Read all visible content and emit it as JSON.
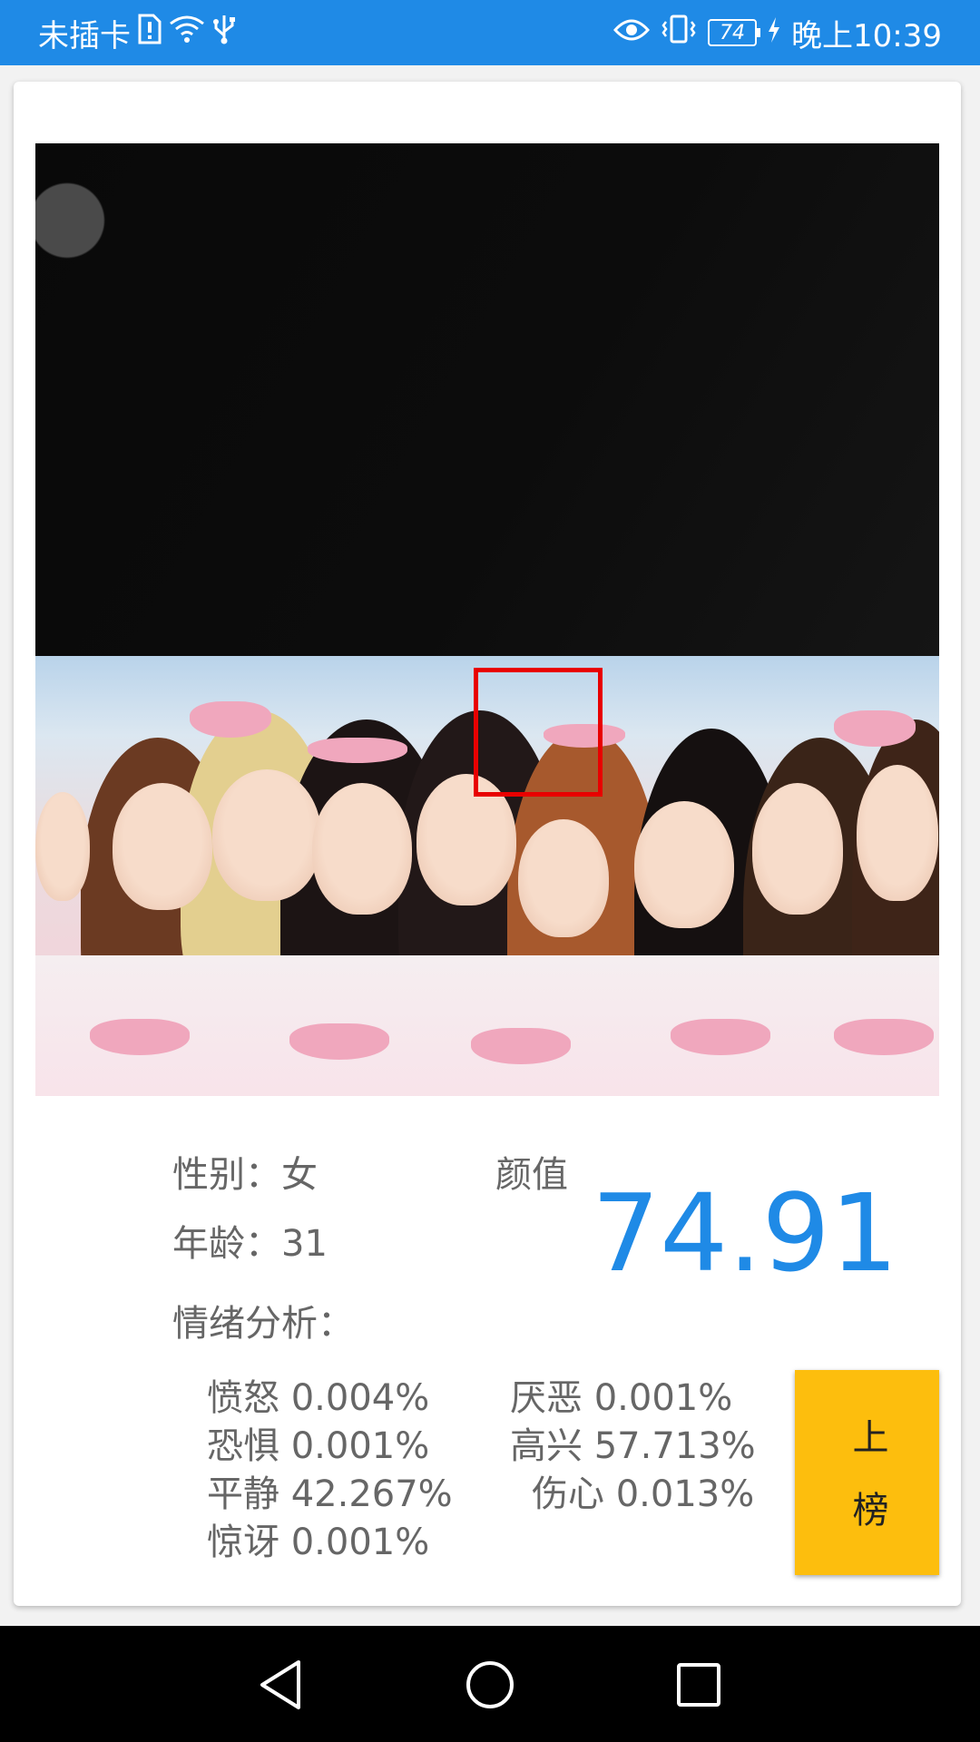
{
  "status_bar": {
    "carrier": "未插卡",
    "battery": "74",
    "time": "晚上10:39",
    "icons": [
      "sim-alert-icon",
      "wifi-icon",
      "usb-icon",
      "eye-icon",
      "vibrate-icon",
      "battery-icon",
      "charging-icon"
    ]
  },
  "result": {
    "gender_label": "性别：",
    "gender_value": "女",
    "age_label": "年龄：",
    "age_value": "31",
    "beauty_label": "颜值",
    "beauty_score": "74.91",
    "emotion_label": "情绪分析：",
    "emotions_left": [
      "愤怒 0.004%",
      "恐惧 0.001%",
      "平静 42.267%",
      "惊讶 0.001%"
    ],
    "emotions_right": [
      "厌恶 0.001%",
      "高兴 57.713%",
      "伤心 0.013%"
    ]
  },
  "rank_button": {
    "label": "上榜"
  },
  "nav": {
    "icons": [
      "back-icon",
      "home-icon",
      "recents-icon"
    ]
  },
  "colors": {
    "accent": "#1f8ae6",
    "rank_button": "#fdbe0d",
    "face_box": "#e80000"
  }
}
